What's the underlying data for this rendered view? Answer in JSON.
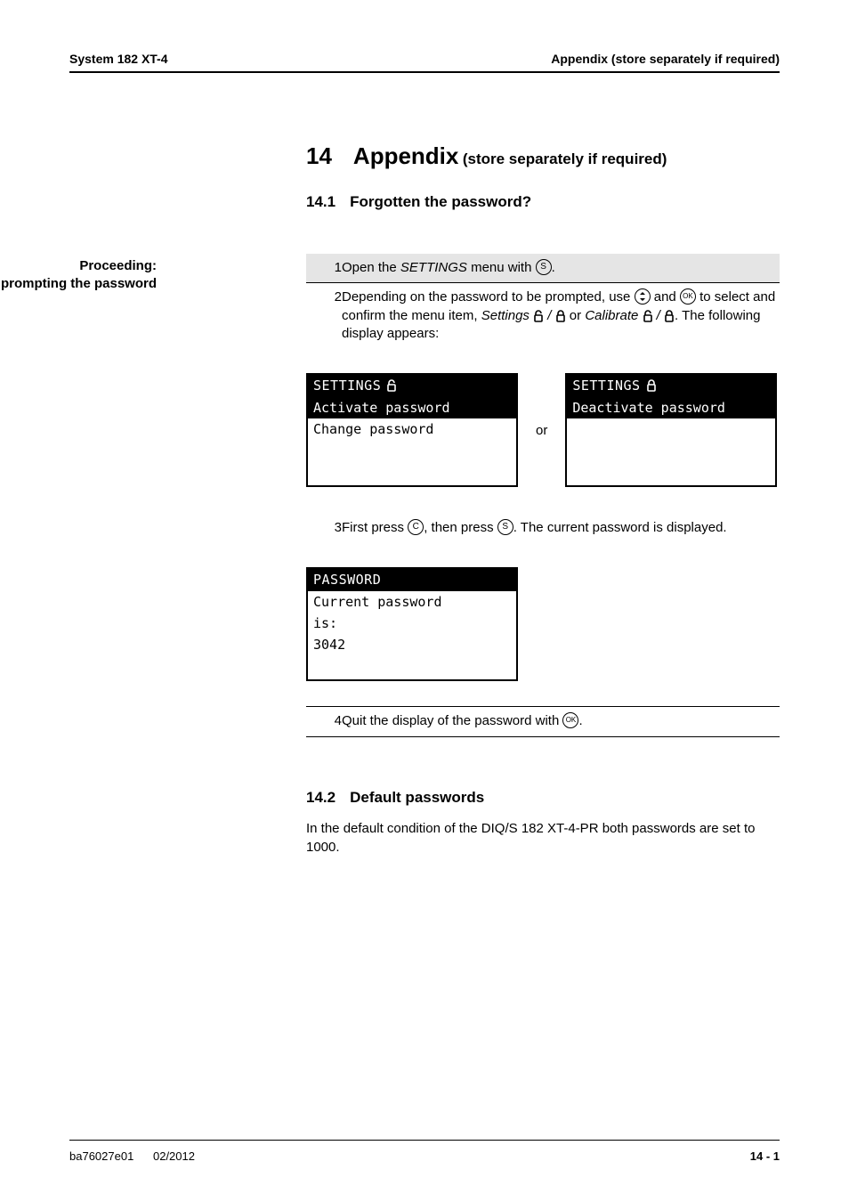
{
  "header": {
    "left": "System 182 XT-4",
    "right": "Appendix (store separately if required)"
  },
  "h1": {
    "num": "14",
    "title": "Appendix",
    "subtitle": "(store separately if required)"
  },
  "h2a": {
    "num": "14.1",
    "title": "Forgotten the password?"
  },
  "sideLabel": {
    "l1": "Proceeding:",
    "l2": "prompting the password"
  },
  "icons": {
    "s": "S",
    "c": "C",
    "ok": "OK"
  },
  "step1": {
    "num": "1",
    "a": "Open the ",
    "b": "SETTINGS",
    "c": " menu with ",
    "d": "."
  },
  "step2": {
    "num": "2",
    "a": "Depending on the password to be prompted, use ",
    "b": " and ",
    "c": " to select and confirm the menu item, ",
    "d": "Settings ",
    "e": " / ",
    "f": " or ",
    "g": "Calibrate ",
    "h": " / ",
    "i": ". The following display appears:"
  },
  "lcd1": {
    "title": "SETTINGS",
    "line1": "Activate password",
    "line2": "Change password"
  },
  "orTxt": "or",
  "lcd2": {
    "title": "SETTINGS",
    "line1": "Deactivate password"
  },
  "step3": {
    "num": "3",
    "a": "First press ",
    "b": ", then press ",
    "c": ". The current password is displayed."
  },
  "lcd3": {
    "title": "PASSWORD",
    "line1": "Current password",
    "line2": "is:",
    "line3": "3042"
  },
  "step4": {
    "num": "4",
    "a": "Quit the display of the password with ",
    "b": "."
  },
  "h2b": {
    "num": "14.2",
    "title": "Default passwords"
  },
  "para": "In the default condition of the DIQ/S 182 XT-4-PR both passwords are set to 1000.",
  "footer": {
    "left1": "ba76027e01",
    "left2": "02/2012",
    "right": "14 - 1"
  }
}
